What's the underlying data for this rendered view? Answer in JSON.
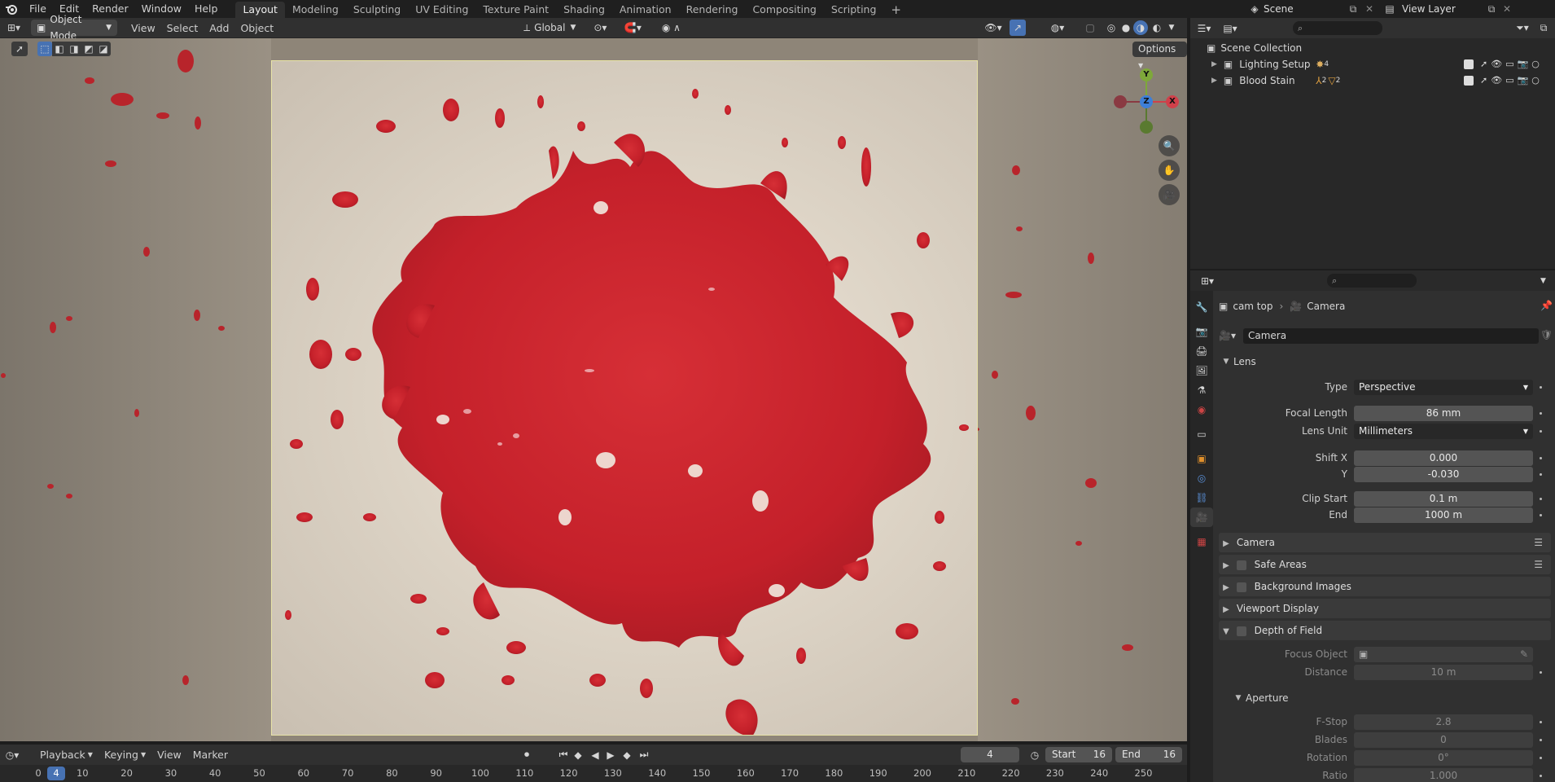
{
  "topbar": {
    "menus": [
      "File",
      "Edit",
      "Render",
      "Window",
      "Help"
    ],
    "workspaces": [
      "Layout",
      "Modeling",
      "Sculpting",
      "UV Editing",
      "Texture Paint",
      "Shading",
      "Animation",
      "Rendering",
      "Compositing",
      "Scripting"
    ],
    "active_workspace": "Layout",
    "scene": "Scene",
    "view_layer": "View Layer"
  },
  "viewport": {
    "mode": "Object Mode",
    "menus": [
      "View",
      "Select",
      "Add",
      "Object"
    ],
    "orientation": "Global",
    "options_label": "Options",
    "gizmo_axes": [
      "X",
      "Y",
      "Z"
    ]
  },
  "timeline": {
    "menus": [
      "Playback",
      "Keying",
      "View",
      "Marker"
    ],
    "current_frame": "4",
    "start_label": "Start",
    "start": "16",
    "end_label": "End",
    "end": "16",
    "ruler_current": "4",
    "ruler": [
      "0",
      "10",
      "20",
      "30",
      "40",
      "50",
      "60",
      "70",
      "80",
      "90",
      "100",
      "110",
      "120",
      "130",
      "140",
      "150",
      "160",
      "170",
      "180",
      "190",
      "200",
      "210",
      "220",
      "230",
      "240",
      "250"
    ]
  },
  "outliner": {
    "root": "Scene Collection",
    "items": [
      {
        "name": "Lighting Setup",
        "badge": "4"
      },
      {
        "name": "Blood Stain",
        "badge1": "2",
        "badge2": "2"
      }
    ]
  },
  "properties": {
    "breadcrumb_object": "cam top",
    "breadcrumb_data": "Camera",
    "datablock": "Camera",
    "lens": {
      "title": "Lens",
      "type_label": "Type",
      "type": "Perspective",
      "focal_label": "Focal Length",
      "focal": "86 mm",
      "unit_label": "Lens Unit",
      "unit": "Millimeters",
      "shiftx_label": "Shift X",
      "shiftx": "0.000",
      "shifty_label": "Y",
      "shifty": "-0.030",
      "clipstart_label": "Clip Start",
      "clipstart": "0.1 m",
      "clipend_label": "End",
      "clipend": "1000 m"
    },
    "panels": {
      "camera": "Camera",
      "safe_areas": "Safe Areas",
      "background_images": "Background Images",
      "viewport_display": "Viewport Display",
      "dof": "Depth of Field"
    },
    "dof": {
      "focus_label": "Focus Object",
      "distance_label": "Distance",
      "distance": "10 m",
      "aperture": "Aperture",
      "fstop_label": "F-Stop",
      "fstop": "2.8",
      "blades_label": "Blades",
      "blades": "0",
      "rotation_label": "Rotation",
      "rotation": "0°",
      "ratio_label": "Ratio",
      "ratio": "1.000"
    }
  },
  "colors": {
    "accent": "#4772b3",
    "blood": "#c4202a",
    "camera_frame": "#e8e3a8"
  }
}
